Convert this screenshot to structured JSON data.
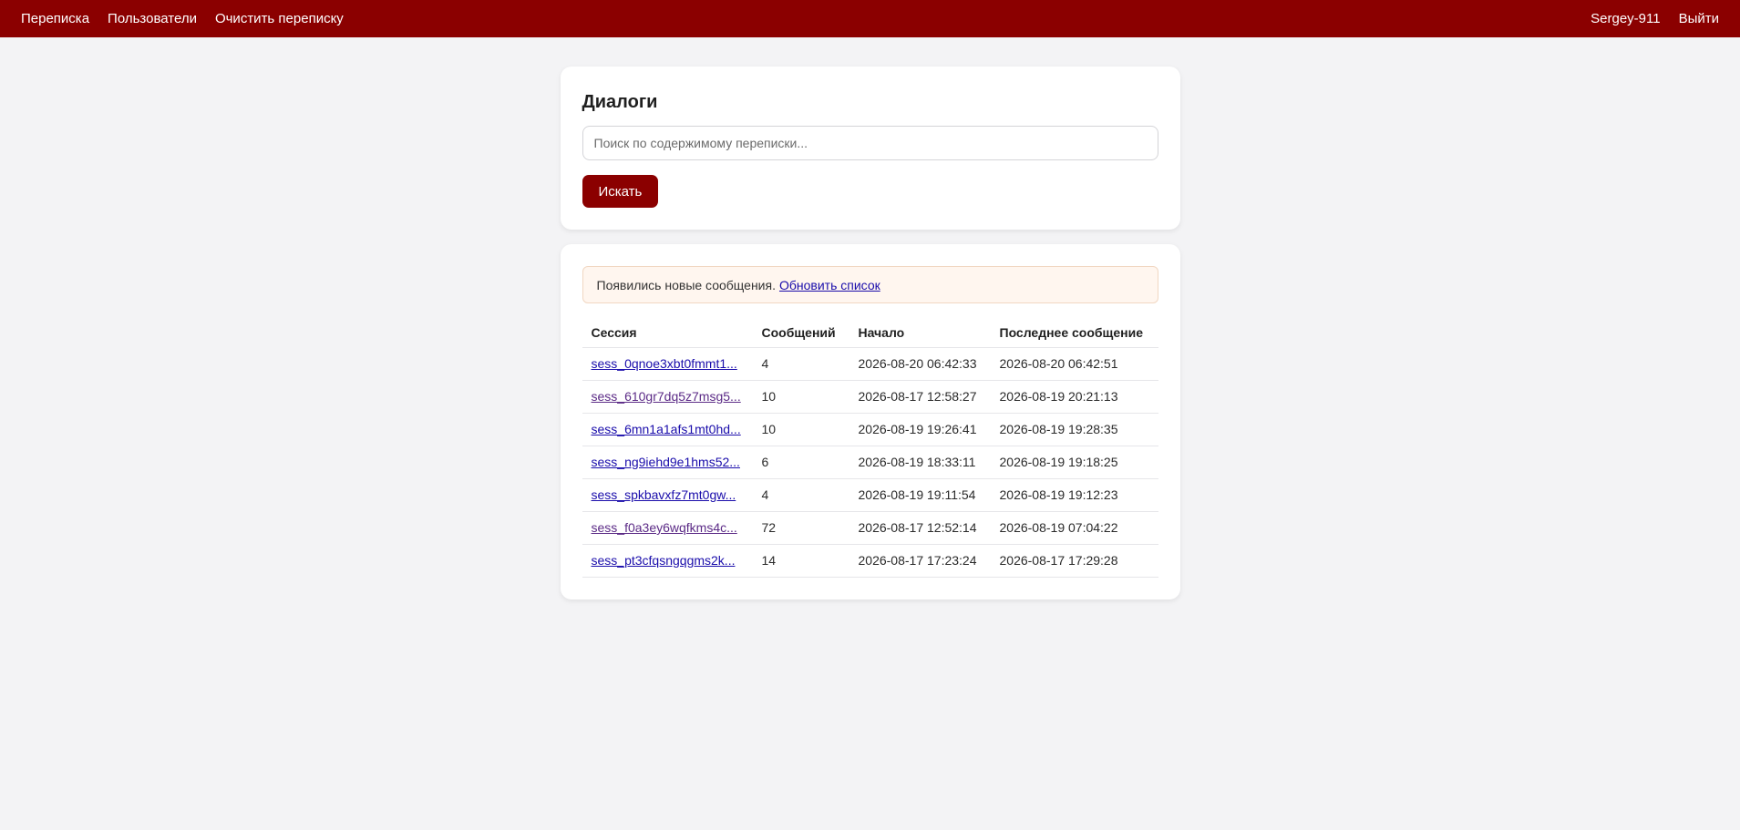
{
  "nav": {
    "items": [
      {
        "label": "Переписка"
      },
      {
        "label": "Пользователи"
      },
      {
        "label": "Очистить переписку"
      }
    ],
    "username": "Sergey-911",
    "logout_label": "Выйти"
  },
  "search": {
    "title": "Диалоги",
    "placeholder": "Поиск по содержимому переписки...",
    "value": "",
    "button_label": "Искать"
  },
  "notice": {
    "text": "Появились новые сообщения.",
    "link_label": "Обновить список"
  },
  "table": {
    "headers": {
      "session": "Сессия",
      "messages": "Сообщений",
      "start": "Начало",
      "last": "Последнее сообщение"
    },
    "rows": [
      {
        "session": "sess_0qnoe3xbt0fmmt1...",
        "messages": "4",
        "start": "2026-08-20 06:42:33",
        "last": "2026-08-20 06:42:51"
      },
      {
        "session": "sess_610gr7dq5z7msg5...",
        "messages": "10",
        "start": "2026-08-17 12:58:27",
        "last": "2026-08-19 20:21:13"
      },
      {
        "session": "sess_6mn1a1afs1mt0hd...",
        "messages": "10",
        "start": "2026-08-19 19:26:41",
        "last": "2026-08-19 19:28:35"
      },
      {
        "session": "sess_ng9iehd9e1hms52...",
        "messages": "6",
        "start": "2026-08-19 18:33:11",
        "last": "2026-08-19 19:18:25"
      },
      {
        "session": "sess_spkbavxfz7mt0gw...",
        "messages": "4",
        "start": "2026-08-19 19:11:54",
        "last": "2026-08-19 19:12:23"
      },
      {
        "session": "sess_f0a3ey6wqfkms4c...",
        "messages": "72",
        "start": "2026-08-17 12:52:14",
        "last": "2026-08-19 07:04:22"
      },
      {
        "session": "sess_pt3cfqsngqgms2k...",
        "messages": "14",
        "start": "2026-08-17 17:23:24",
        "last": "2026-08-17 17:29:28"
      }
    ]
  },
  "colors": {
    "brand": "#8b0000",
    "link": "#1a0dab",
    "link_visited": "#5b2a86",
    "notice_bg": "#fff6ef"
  }
}
